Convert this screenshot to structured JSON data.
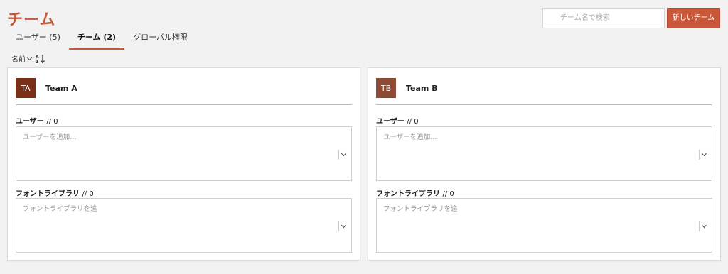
{
  "header": {
    "title": "チーム",
    "search_placeholder": "チーム名で検索",
    "new_team_label": "新しいチーム"
  },
  "tabs": [
    {
      "label": "ユーザー (5)",
      "active": false
    },
    {
      "label": "チーム (2)",
      "active": true
    },
    {
      "label": "グローバル権限",
      "active": false
    }
  ],
  "sort": {
    "label": "名前",
    "direction_icon": "sort-az-icon"
  },
  "teams": [
    {
      "initials": "TA",
      "name": "Team A",
      "avatar_color": "#7a2e16",
      "users_label": "ユーザー",
      "users_count": "// 0",
      "users_placeholder": "ユーザーを追加...",
      "fonts_label": "フォントライブラリ",
      "fonts_count": "// 0",
      "fonts_placeholder": "フォントライブラリを追"
    },
    {
      "initials": "TB",
      "name": "Team B",
      "avatar_color": "#8f4a33",
      "users_label": "ユーザー",
      "users_count": "// 0",
      "users_placeholder": "ユーザーを追加...",
      "fonts_label": "フォントライブラリ",
      "fonts_count": "// 0",
      "fonts_placeholder": "フォントライブラリを追"
    }
  ],
  "colors": {
    "accent": "#c45a3c",
    "button": "#c9573a"
  }
}
